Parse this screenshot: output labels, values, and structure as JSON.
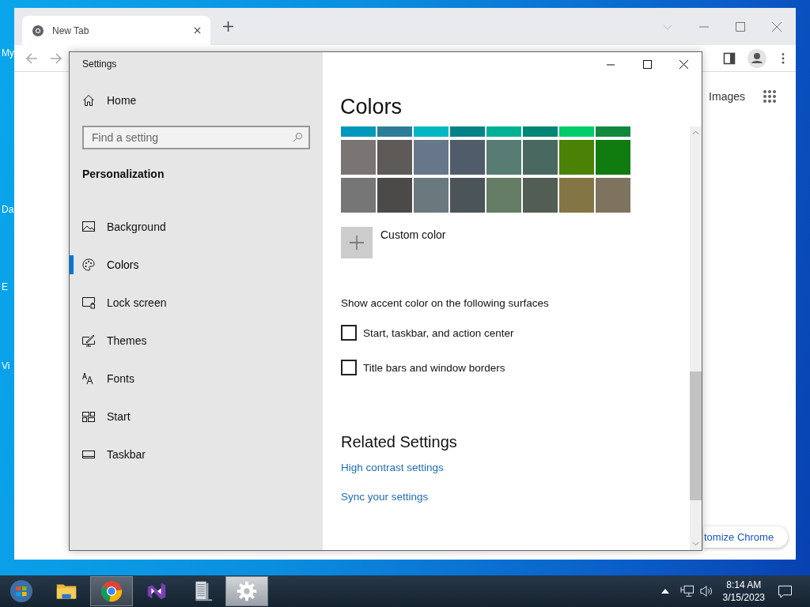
{
  "desktop": {
    "icon_labels": [
      "My",
      "Da",
      "E",
      "Vi"
    ]
  },
  "browser": {
    "tabs": [
      {
        "title": "New Tab",
        "selected": true
      }
    ],
    "page": {
      "links": [
        "Images"
      ],
      "customize_button": "tomize Chrome"
    }
  },
  "settings": {
    "window_title": "Settings",
    "home": "Home",
    "search": {
      "placeholder": "Find a setting"
    },
    "section": "Personalization",
    "nav": [
      {
        "label": "Background",
        "kind": "background",
        "selected": false
      },
      {
        "label": "Colors",
        "kind": "colors",
        "selected": true
      },
      {
        "label": "Lock screen",
        "kind": "lockscreen",
        "selected": false
      },
      {
        "label": "Themes",
        "kind": "themes",
        "selected": false
      },
      {
        "label": "Fonts",
        "kind": "fonts",
        "selected": false
      },
      {
        "label": "Start",
        "kind": "start",
        "selected": false
      },
      {
        "label": "Taskbar",
        "kind": "taskbar",
        "selected": false
      }
    ],
    "heading": "Colors",
    "swatch_rows": [
      [
        {
          "color": "#0099bc"
        },
        {
          "color": "#2d7d9a"
        },
        {
          "color": "#00b7c3"
        },
        {
          "color": "#038387"
        },
        {
          "color": "#00b294"
        },
        {
          "color": "#018574"
        },
        {
          "color": "#00cc6a"
        },
        {
          "color": "#10893e"
        }
      ],
      [
        {
          "color": "#7a7574"
        },
        {
          "color": "#5d5a58"
        },
        {
          "color": "#68768a"
        },
        {
          "color": "#515c6b"
        },
        {
          "color": "#567c73"
        },
        {
          "color": "#486860"
        },
        {
          "color": "#498205"
        },
        {
          "color": "#107c10"
        }
      ],
      [
        {
          "color": "#767676"
        },
        {
          "color": "#4c4a48"
        },
        {
          "color": "#69797e"
        },
        {
          "color": "#4a5459"
        },
        {
          "color": "#647c64"
        },
        {
          "color": "#525e54"
        },
        {
          "color": "#847545"
        },
        {
          "color": "#7e735f"
        }
      ]
    ],
    "custom_color": "Custom color",
    "surfaces_heading": "Show accent color on the following surfaces",
    "surfaces": [
      {
        "label": "Start, taskbar, and action center",
        "checked": false
      },
      {
        "label": "Title bars and window borders",
        "checked": false
      }
    ],
    "related_heading": "Related Settings",
    "related_links": [
      "High contrast settings",
      "Sync your settings"
    ]
  },
  "taskbar": {
    "apps": [
      {
        "kind": "start",
        "selected": false
      },
      {
        "kind": "explorer",
        "selected": false
      },
      {
        "kind": "chrome",
        "selected": true
      },
      {
        "kind": "studio",
        "selected": false
      },
      {
        "kind": "document",
        "selected": false
      },
      {
        "kind": "settings",
        "selected": true
      }
    ],
    "clock": {
      "time": "8:14 AM",
      "date": "3/15/2023"
    }
  }
}
